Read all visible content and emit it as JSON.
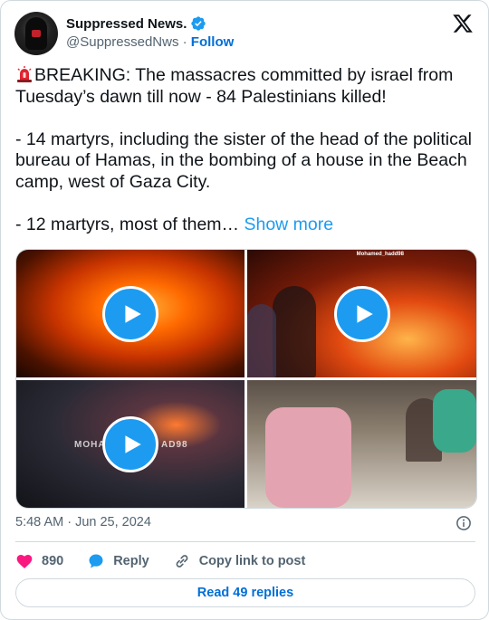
{
  "author": {
    "name": "Suppressed News.",
    "handle": "@SuppressedNws",
    "separator": "·",
    "follow_label": "Follow",
    "verified_color": "#1d9bf0"
  },
  "brand_icon": "x-logo-icon",
  "post": {
    "emoji": "siren-emoji",
    "text": "BREAKING: The massacres committed by israel from Tuesday’s dawn till now - 84 Palestinians killed!\n\n- 14 martyrs, including the sister of the head of the political bureau of Hamas, in the bombing of a house in the Beach camp, west of Gaza City.\n\n- 12 martyrs, most of them… ",
    "show_more_label": "Show more"
  },
  "media": {
    "tiles": [
      {
        "kind": "video",
        "description_icon": "play-icon"
      },
      {
        "kind": "video",
        "description_icon": "play-icon",
        "watermark": "Mohamed_hadd98"
      },
      {
        "kind": "video",
        "description_icon": "play-icon",
        "watermark_left": "MOHA",
        "watermark_right": "AD98"
      },
      {
        "kind": "image"
      }
    ]
  },
  "timestamp": "5:48 AM · Jun 25, 2024",
  "actions": {
    "like_count": "890",
    "reply_label": "Reply",
    "copy_label": "Copy link to post"
  },
  "read_replies_label": "Read 49 replies",
  "colors": {
    "accent": "#1d9bf0",
    "link": "#006fd6",
    "like": "#f91880",
    "muted": "#536471"
  }
}
